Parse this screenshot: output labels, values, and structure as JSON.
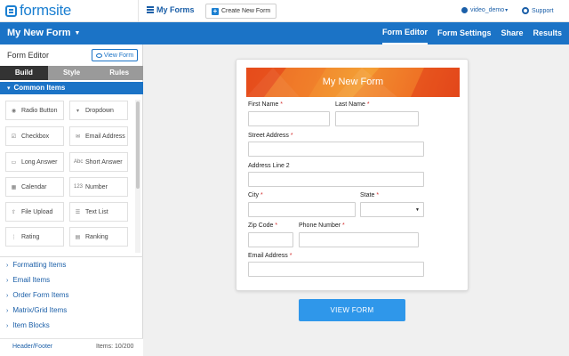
{
  "topbar": {
    "logo": "formsite",
    "my_forms": "My Forms",
    "create_form": "Create New Form",
    "user": "video_demo",
    "user_caret": "▾",
    "support": "Support"
  },
  "header": {
    "form_name": "My New Form",
    "caret": "▼",
    "tabs": [
      "Form Editor",
      "Form Settings",
      "Share",
      "Results"
    ]
  },
  "left": {
    "title": "Form Editor",
    "view_form": "View Form",
    "subtabs": [
      "Build",
      "Style",
      "Rules"
    ],
    "common_items": "Common Items",
    "items": [
      {
        "label": "Radio Button",
        "icon": "◉"
      },
      {
        "label": "Dropdown",
        "icon": "▾"
      },
      {
        "label": "Checkbox",
        "icon": "☑"
      },
      {
        "label": "Email Address",
        "icon": "✉"
      },
      {
        "label": "Long Answer",
        "icon": "▭"
      },
      {
        "label": "Short Answer",
        "icon": "Abc"
      },
      {
        "label": "Calendar",
        "icon": "▦"
      },
      {
        "label": "Number",
        "icon": "123"
      },
      {
        "label": "File Upload",
        "icon": "⇧"
      },
      {
        "label": "Text List",
        "icon": "☰"
      },
      {
        "label": "Rating",
        "icon": "⋮"
      },
      {
        "label": "Ranking",
        "icon": "▤"
      }
    ],
    "sections": [
      "Formatting Items",
      "Email Items",
      "Order Form Items",
      "Matrix/Grid Items",
      "Item Blocks"
    ],
    "footer_link": "Header/Footer",
    "items_count": "Items: 10/200"
  },
  "form": {
    "title": "My New Form",
    "required_mark": "*",
    "fields": {
      "first_name": "First Name",
      "last_name": "Last Name",
      "street": "Street Address",
      "line2": "Address Line 2",
      "city": "City",
      "state": "State",
      "zip": "Zip Code",
      "phone": "Phone Number",
      "email": "Email Address"
    },
    "view_button": "VIEW FORM"
  }
}
